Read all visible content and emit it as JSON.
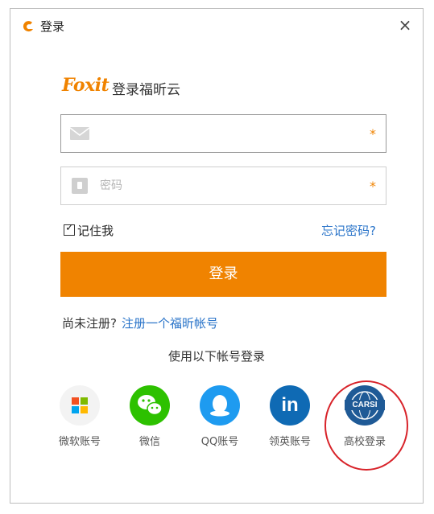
{
  "window": {
    "title": "登录",
    "close_label": "×"
  },
  "brand": {
    "logo_text": "Foxit",
    "title": "登录福昕云"
  },
  "email": {
    "value": "",
    "placeholder": "",
    "required_mark": "*"
  },
  "password": {
    "value": "",
    "placeholder": "密码",
    "required_mark": "*"
  },
  "remember": {
    "label": "记住我",
    "checked": true,
    "tick": "✓"
  },
  "forgot_label": "忘记密码?",
  "login_label": "登录",
  "register": {
    "prompt": "尚未注册?",
    "link": "注册一个福昕帐号"
  },
  "other_login_title": "使用以下帐号登录",
  "social": [
    {
      "label": "微软账号",
      "icon": "microsoft-icon"
    },
    {
      "label": "微信",
      "icon": "wechat-icon"
    },
    {
      "label": "QQ账号",
      "icon": "qq-icon"
    },
    {
      "label": "领英账号",
      "icon": "linkedin-icon",
      "glyph": "in"
    },
    {
      "label": "高校登录",
      "icon": "carsi-icon",
      "glyph": "CARSI"
    }
  ],
  "colors": {
    "accent": "#f08300",
    "link": "#2a74c9",
    "wechat": "#2dc100",
    "qq": "#1e9bf0",
    "linkedin": "#0f6ab4",
    "carsi": "#1f5a96",
    "highlight": "#d8232a"
  }
}
